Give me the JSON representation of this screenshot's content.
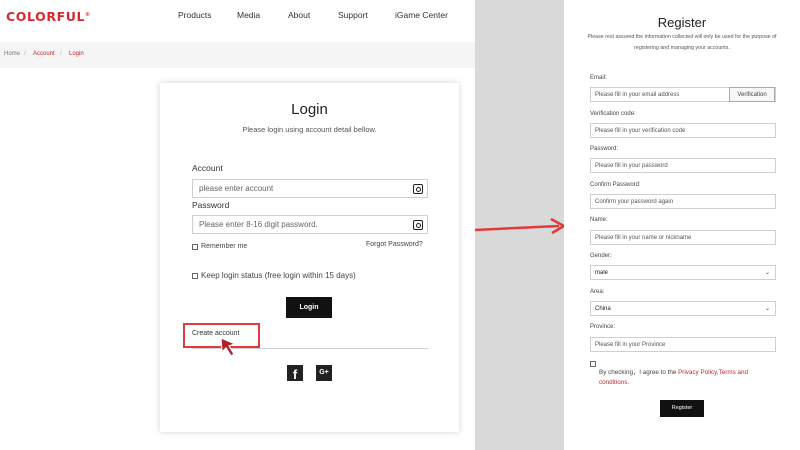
{
  "brand": {
    "logo_text": "COLORFUL",
    "logo_mark": "®"
  },
  "nav": {
    "items": [
      "Products",
      "Media",
      "About",
      "Support",
      "iGame Center"
    ]
  },
  "breadcrumb": {
    "home": "Home",
    "sep": "/",
    "account": "Account",
    "current": "Login"
  },
  "login": {
    "title": "Login",
    "subtitle": "Please login using account detail bellow.",
    "account_label": "Account",
    "account_placeholder": "please enter account",
    "password_label": "Password",
    "password_placeholder": "Please enter 8-16 digit password.",
    "remember_label": "Remember me",
    "forgot_label": "Forgot Password?",
    "keep_label": "Keep login status (free login within 15 days)",
    "login_button": "Login",
    "create_account": "Create account",
    "social_facebook": "f",
    "social_google": "G+"
  },
  "register": {
    "title": "Register",
    "subtitle": "Please rest assured the information collected will only be used for the purpose of registering and managing your accounts.",
    "email_label": "Email:",
    "email_placeholder": "Please fill in your email address",
    "verify_button": "Verification",
    "code_label": "Verification code:",
    "code_placeholder": "Please fill in your verification code",
    "password_label": "Password:",
    "password_placeholder": "Please fill in your password",
    "confirm_label": "Confirm Password:",
    "confirm_placeholder": "Confirm your password again",
    "name_label": "Name:",
    "name_placeholder": "Please fill in your name or nickname",
    "gender_label": "Gender:",
    "gender_value": "male",
    "area_label": "Area:",
    "area_value": "China",
    "province_label": "Province:",
    "province_placeholder": "Please fill in your Province",
    "agree_text": "By checking，I agree to the ",
    "agree_link": "Privacy Policy,Terms and conditions",
    "agree_end": ".",
    "register_button": "Register"
  },
  "colors": {
    "brand_red": "#d7282f",
    "highlight_red": "#e23a3a",
    "button_black": "#111111"
  }
}
